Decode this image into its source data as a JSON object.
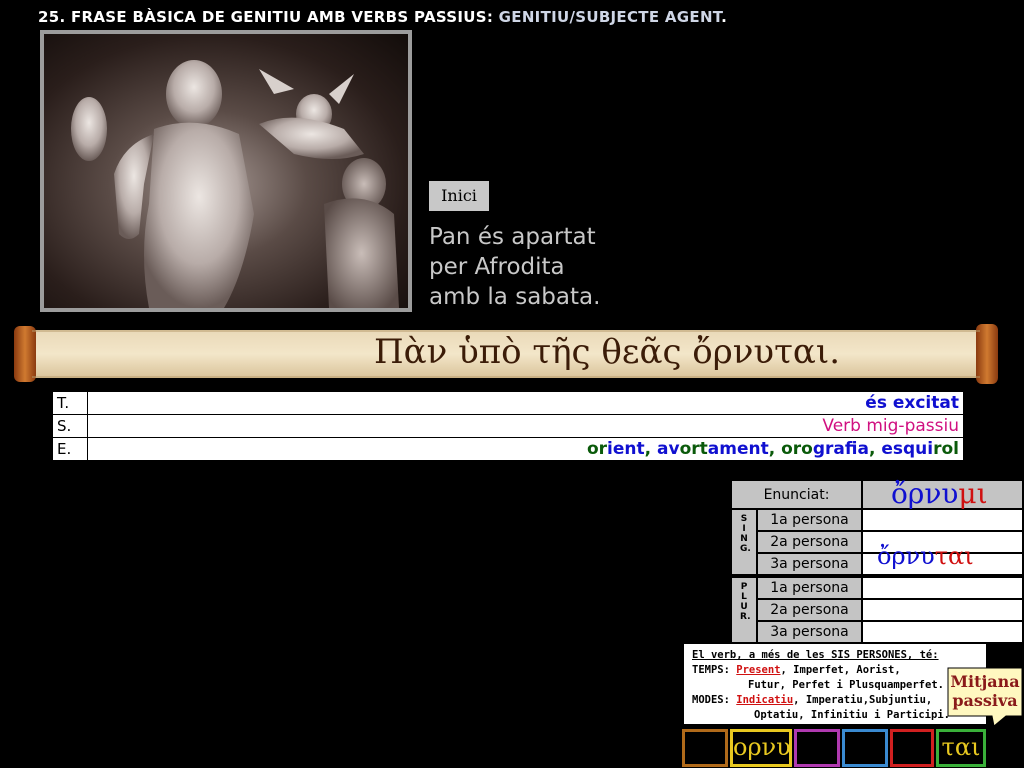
{
  "header": {
    "title_main": "25. FRASE BÀSICA DE GENITIU AMB VERBS PASSIUS: ",
    "title_highlight": "GENITIU/SUBJECTE AGENT",
    "title_end": "."
  },
  "nav": {
    "inici_label": "Inici"
  },
  "sentence": {
    "line1": "Pan és apartat",
    "line2": "per Afrodita",
    "line3": "amb la sabata."
  },
  "greek_sentence": "Πὰν ὑπὸ τῆς θεᾶς ὄρνυται.",
  "tse_table": {
    "t_label": "T.",
    "t_value": "és excitat",
    "s_label": "S.",
    "s_value": "Verb mig-passiu",
    "e_label": "E.",
    "e_parts": [
      {
        "text": "or",
        "color": "green"
      },
      {
        "text": "ient",
        "color": "blue"
      },
      {
        "text": ", ",
        "color": "green"
      },
      {
        "text": "av",
        "color": "blue"
      },
      {
        "text": "ort",
        "color": "green"
      },
      {
        "text": "ament",
        "color": "blue"
      },
      {
        "text": ", ",
        "color": "green"
      },
      {
        "text": "oro",
        "color": "green"
      },
      {
        "text": "grafia",
        "color": "blue"
      },
      {
        "text": ", ",
        "color": "green"
      },
      {
        "text": "esqui",
        "color": "blue"
      },
      {
        "text": "rol",
        "color": "green"
      }
    ]
  },
  "conjugation": {
    "enunciat_label": "Enunciat:",
    "enunciat_value": "ὄρνυμι",
    "sing_label": "S I N G.",
    "plur_label": "P L U R.",
    "persons": [
      "1a persona",
      "2a persona",
      "3a persona"
    ],
    "sing_3a_value": "ὄρνυται"
  },
  "info": {
    "line1": "El verb, a més de les SIS PERSONES, té:",
    "temps_label": "TEMPS: ",
    "temps_active": "Present",
    "temps_rest": ", Imperfet, Aorist,",
    "temps_line2": "Futur, Perfet i Plusquamperfet.",
    "modes_label": "MODES: ",
    "modes_active": "Indicatiu",
    "modes_rest": ", Imperatiu,Subjuntiu,",
    "modes_line2": "Optatiu, Infinitiu i Participi."
  },
  "badge": {
    "line1": "Mitjana",
    "line2": "passiva"
  },
  "bottom_buttons": [
    {
      "label": "",
      "border": "#b06a1a"
    },
    {
      "label": "ορνυ",
      "border": "#e8c820"
    },
    {
      "label": "",
      "border": "#b03ab0"
    },
    {
      "label": "",
      "border": "#3a8ad0"
    },
    {
      "label": "",
      "border": "#d02020"
    },
    {
      "label": "ται",
      "border": "#3ab03a"
    }
  ],
  "colors": {
    "greek_red": "#d01010",
    "greek_blue": "#1010d0",
    "bottom_text": "#e8c820"
  }
}
